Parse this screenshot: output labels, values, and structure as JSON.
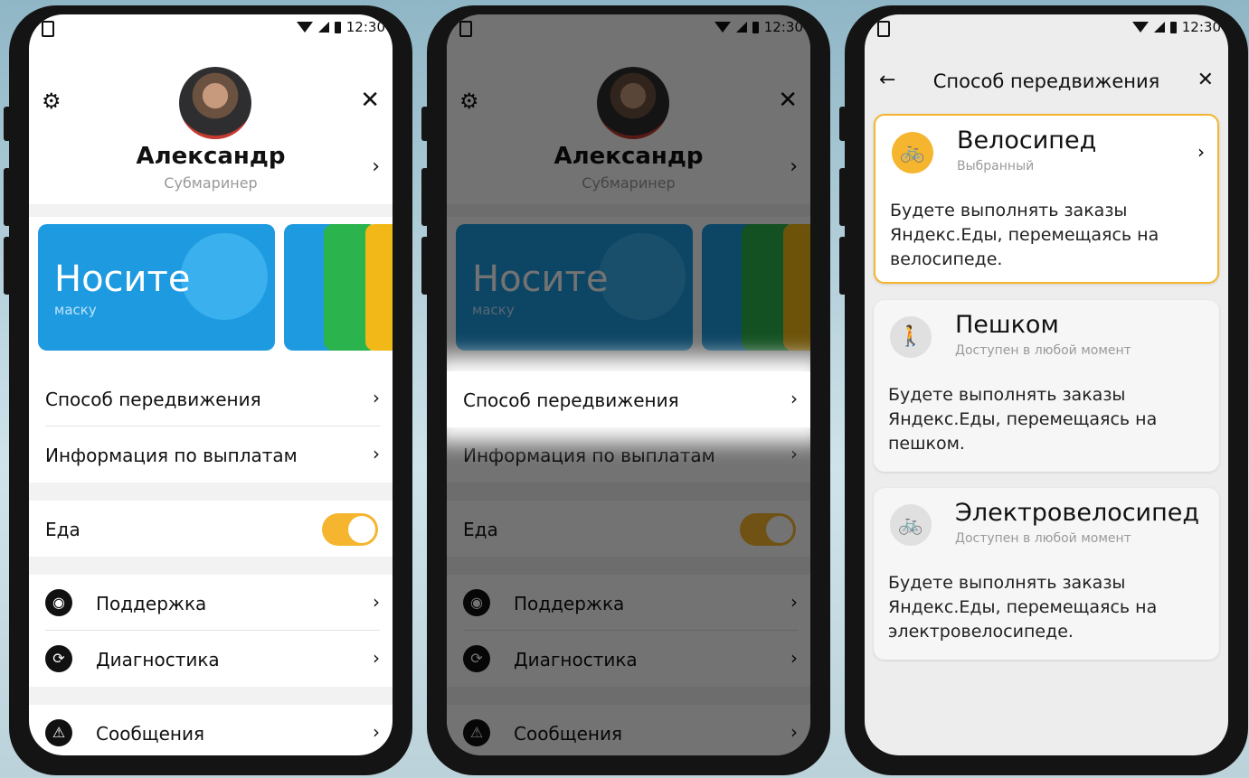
{
  "status": {
    "time": "12:30"
  },
  "profile": {
    "name": "Александр",
    "subtitle": "Субмаринер"
  },
  "story": {
    "title": "Носите",
    "subtitle": "маску"
  },
  "menu": {
    "transport": "Способ передвижения",
    "payouts": "Информация по выплатам",
    "food": "Еда",
    "support": "Поддержка",
    "diagnostics": "Диагностика",
    "messages": "Сообщения"
  },
  "transport_screen": {
    "title": "Способ передвижения",
    "options": [
      {
        "title": "Велосипед",
        "status": "Выбранный",
        "desc": "Будете выполнять заказы Яндекс.Еды, перемещаясь на велосипеде.",
        "icon": "bicycle-icon"
      },
      {
        "title": "Пешком",
        "status": "Доступен в любой момент",
        "desc": "Будете выполнять заказы Яндекс.Еды, перемещаясь на пешком.",
        "icon": "walking-icon"
      },
      {
        "title": "Электровелосипед",
        "status": "Доступен в любой момент",
        "desc": "Будете выполнять заказы Яндекс.Еды, перемещаясь на электровелосипеде.",
        "icon": "ebike-icon"
      }
    ]
  },
  "colors": {
    "accent": "#f5b52e",
    "story_blue": "#1e9be0",
    "story_green": "#2bb34d",
    "story_yellow": "#f2b818"
  }
}
